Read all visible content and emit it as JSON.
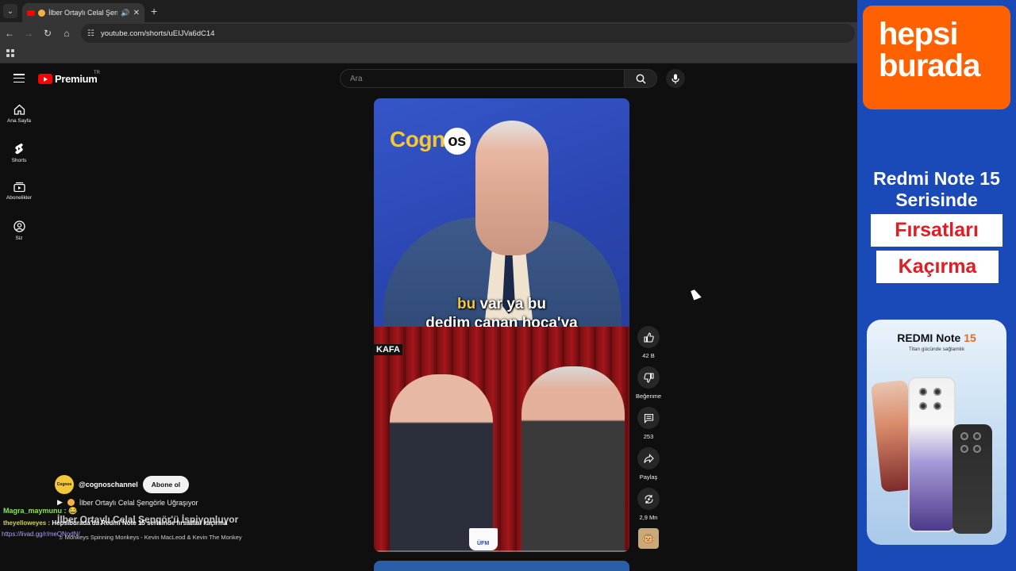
{
  "browser": {
    "tab_title": "İlber Ortaylı Celal Şeng",
    "url": "youtube.com/shorts/uEIJVa6dC14",
    "new_tab_label": "+"
  },
  "youtube": {
    "logo_text": "Premium",
    "logo_region": "TR",
    "search_placeholder": "Ara",
    "guide": [
      {
        "label": "Ana Sayfa",
        "icon": "home-icon"
      },
      {
        "label": "Shorts",
        "icon": "shorts-icon"
      },
      {
        "label": "Abonelikler",
        "icon": "subscriptions-icon"
      },
      {
        "label": "Siz",
        "icon": "you-icon"
      }
    ]
  },
  "short": {
    "brand_text": "Cogn",
    "brand_badge": "os",
    "subtitle_highlight": "bu",
    "subtitle_line1_rest": " var ya bu",
    "subtitle_line2": "dedim canan hoca'ya",
    "lower_tag": "KAFA",
    "cup_label": "ÜFM",
    "channel_avatar_text": "Cognos",
    "channel_name": "@cognoschannel",
    "subscribe_label": "Abone ol",
    "video_title": "İlber Ortaylı Celal Şengörle Uğraşıyor"
  },
  "actions": {
    "likes": "42 B",
    "dislike_label": "Beğenme",
    "comments": "253",
    "share_label": "Paylaş",
    "remix_count": "2,9 Mn"
  },
  "overlay": {
    "chat1_user": "Magra_maymunu :",
    "overlay_title": "İlber Ortaylı Celal Şengör'ü İspiyonluyor",
    "chat2_user": "theyelloweyes :",
    "chat2_msg": "Hepsiburada'da Redmi Note 15 serisinde fırsatları kaçırma",
    "chat3_link": "https://livad.gg/r/meQNodN/",
    "music": "Monkeys Spinning Monkeys - Kevin MacLeod & Kevin The Monkey"
  },
  "ad": {
    "logo_line1": "hepsi",
    "logo_line2": "burada",
    "headline_line1": "Redmi Note 15",
    "headline_line2": "Serisinde",
    "box1": "Fırsatları",
    "box2": "Kaçırma",
    "card_title": "REDMI Note ",
    "card_num": "15",
    "card_sub": "Titan gücünde sağlamlık"
  },
  "colors": {
    "youtube_red": "#ff0000",
    "hepsiburada_orange": "#ff6000",
    "ad_blue": "#1a4ab8"
  }
}
